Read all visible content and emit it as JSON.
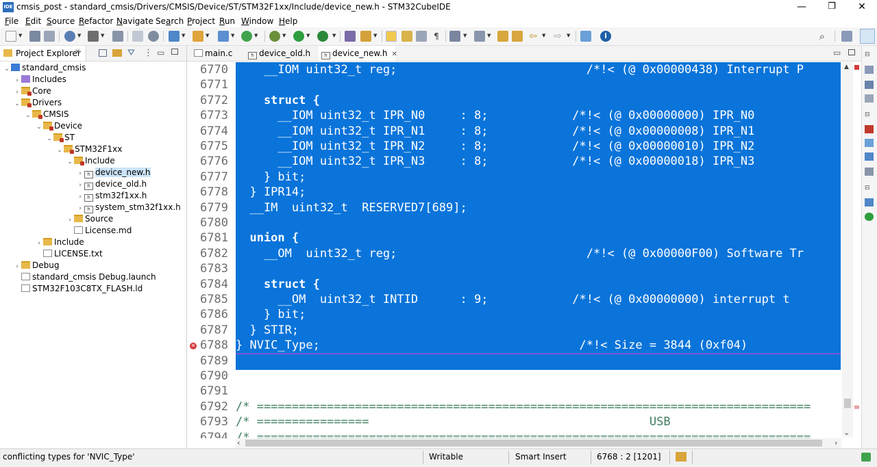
{
  "window": {
    "title": "cmsis_post - standard_cmsis/Drivers/CMSIS/Device/ST/STM32F1xx/Include/device_new.h - STM32CubeIDE",
    "app_icon_text": "IDE",
    "minimize": "—",
    "restore": "❐",
    "close": "✕"
  },
  "menu": [
    {
      "label": "File",
      "u": "F",
      "rest": "ile"
    },
    {
      "label": "Edit",
      "u": "E",
      "rest": "dit"
    },
    {
      "label": "Source",
      "u": "S",
      "rest": "ource"
    },
    {
      "label": "Refactor",
      "u": "R",
      "rest": "efactor"
    },
    {
      "label": "Navigate",
      "u": "N",
      "rest": "avigate"
    },
    {
      "label": "Search",
      "u": "S",
      "rest": "earch",
      "pre": "Se",
      "u2": "a",
      "rest2": "rch"
    },
    {
      "label": "Project",
      "u": "P",
      "rest": "roject"
    },
    {
      "label": "Run",
      "u": "R",
      "rest": "un"
    },
    {
      "label": "Window",
      "u": "W",
      "rest": "indow"
    },
    {
      "label": "Help",
      "u": "H",
      "rest": "elp"
    }
  ],
  "project_explorer": {
    "tab_label": "Project Explorer",
    "tab_close": "✕",
    "tree": [
      {
        "label": "standard_cmsis"
      },
      {
        "label": "Includes"
      },
      {
        "label": "Core"
      },
      {
        "label": "Drivers"
      },
      {
        "label": "CMSIS"
      },
      {
        "label": "Device"
      },
      {
        "label": "ST"
      },
      {
        "label": "STM32F1xx"
      },
      {
        "label": "Include"
      },
      {
        "label": "device_new.h"
      },
      {
        "label": "device_old.h"
      },
      {
        "label": "stm32f1xx.h"
      },
      {
        "label": "system_stm32f1xx.h"
      },
      {
        "label": "Source"
      },
      {
        "label": "License.md"
      },
      {
        "label": "Include"
      },
      {
        "label": "LICENSE.txt"
      },
      {
        "label": "Debug"
      },
      {
        "label": "standard_cmsis Debug.launch"
      },
      {
        "label": "STM32F103C8TX_FLASH.ld"
      }
    ]
  },
  "editor": {
    "tabs": [
      {
        "label": "main.c"
      },
      {
        "label": "device_old.h"
      },
      {
        "label": "device_new.h"
      }
    ],
    "active_tab_close": "✕",
    "lines": [
      {
        "n": "6770",
        "t": "    __IOM uint32_t reg;                           /*!< (@ 0x00000438) Interrupt P"
      },
      {
        "n": "6771",
        "t": ""
      },
      {
        "n": "6772",
        "t": "    struct {"
      },
      {
        "n": "6773",
        "t": "      __IOM uint32_t IPR_N0     : 8;            /*!< (@ 0x00000000) IPR_N0"
      },
      {
        "n": "6774",
        "t": "      __IOM uint32_t IPR_N1     : 8;            /*!< (@ 0x00000008) IPR_N1"
      },
      {
        "n": "6775",
        "t": "      __IOM uint32_t IPR_N2     : 8;            /*!< (@ 0x00000010) IPR_N2"
      },
      {
        "n": "6776",
        "t": "      __IOM uint32_t IPR_N3     : 8;            /*!< (@ 0x00000018) IPR_N3"
      },
      {
        "n": "6777",
        "t": "    } bit;"
      },
      {
        "n": "6778",
        "t": "  } IPR14;"
      },
      {
        "n": "6779",
        "t": "  __IM  uint32_t  RESERVED7[689];"
      },
      {
        "n": "6780",
        "t": ""
      },
      {
        "n": "6781",
        "t": "  union {"
      },
      {
        "n": "6782",
        "t": "    __OM  uint32_t reg;                           /*!< (@ 0x00000F00) Software Tr"
      },
      {
        "n": "6783",
        "t": ""
      },
      {
        "n": "6784",
        "t": "    struct {"
      },
      {
        "n": "6785",
        "t": "      __OM  uint32_t INTID      : 9;            /*!< (@ 0x00000000) interrupt t"
      },
      {
        "n": "6786",
        "t": "    } bit;"
      },
      {
        "n": "6787",
        "t": "  } STIR;"
      },
      {
        "n": "6788",
        "t": "} NVIC_Type;                                     /*!< Size = 3844 (0xf04)"
      },
      {
        "n": "6789",
        "t": ""
      },
      {
        "n": "6790",
        "t": ""
      },
      {
        "n": "6791",
        "t": ""
      },
      {
        "n": "6792",
        "t": "/* ==============================================================================="
      },
      {
        "n": "6793",
        "t": "/* ================                                        USB"
      },
      {
        "n": "6794",
        "t": "/* ==============================================================================="
      }
    ]
  },
  "status": {
    "message": "conflicting types for 'NVIC_Type'",
    "writable": "Writable",
    "insert_mode": "Smart Insert",
    "position": "6768 : 2 [1201]"
  },
  "colors": {
    "selection": "#0a74da",
    "error": "#d23a3a",
    "comment": "#3f7f5f"
  }
}
